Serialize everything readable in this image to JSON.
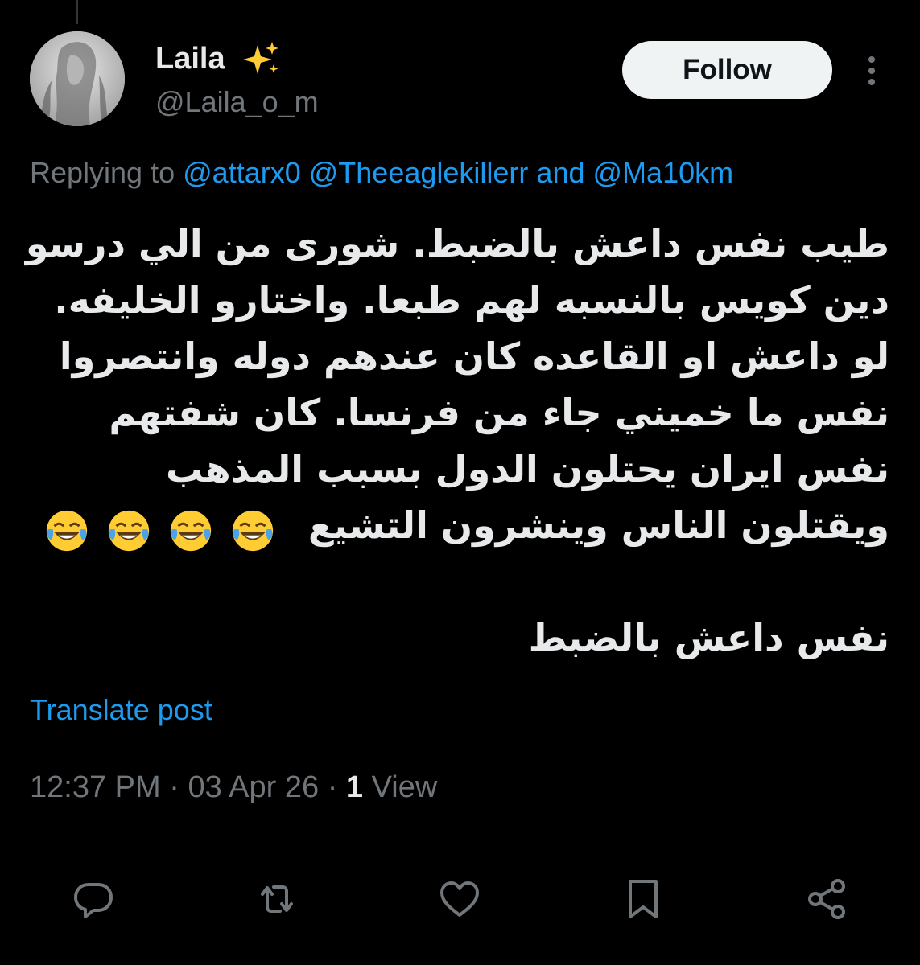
{
  "author": {
    "display_name": "Laila",
    "handle": "@Laila_o_m",
    "name_emoji": "sparkles-icon"
  },
  "follow_label": "Follow",
  "replying": {
    "prefix": "Replying to",
    "mentions": [
      "@attarx0",
      "@Theeaglekillerr",
      "@Ma10km"
    ],
    "conjunction": "and"
  },
  "tweet": {
    "lines": [
      "طيب نفس داعش بالضبط. شورى من الي درسو",
      "دين كويس بالنسبه لهم طبعا. واختارو الخليفه.",
      "لو داعش او القاعده كان عندهم دوله وانتصروا",
      "نفس ما خميني جاء من فرنسا.   كان شفتهم",
      "نفس ايران يحتلون الدول بسبب المذهب",
      "ويقتلون الناس وينشرون التشيع"
    ],
    "emojis": [
      "face-with-tears-of-joy-icon",
      "face-with-tears-of-joy-icon",
      "face-with-tears-of-joy-icon",
      "face-with-tears-of-joy-icon"
    ],
    "final_line": "نفس داعش بالضبط"
  },
  "translate_label": "Translate post",
  "meta": {
    "time": "12:37 PM",
    "separator": "·",
    "date": "03 Apr 26",
    "views_count": "1",
    "views_label": "View"
  },
  "actions": [
    "reply-icon",
    "repost-icon",
    "like-icon",
    "bookmark-icon",
    "share-icon"
  ],
  "colors": {
    "background": "#000000",
    "text": "#e7e9ea",
    "secondary": "#71767b",
    "link": "#1d9bf0",
    "follow_bg": "#eff3f4"
  }
}
